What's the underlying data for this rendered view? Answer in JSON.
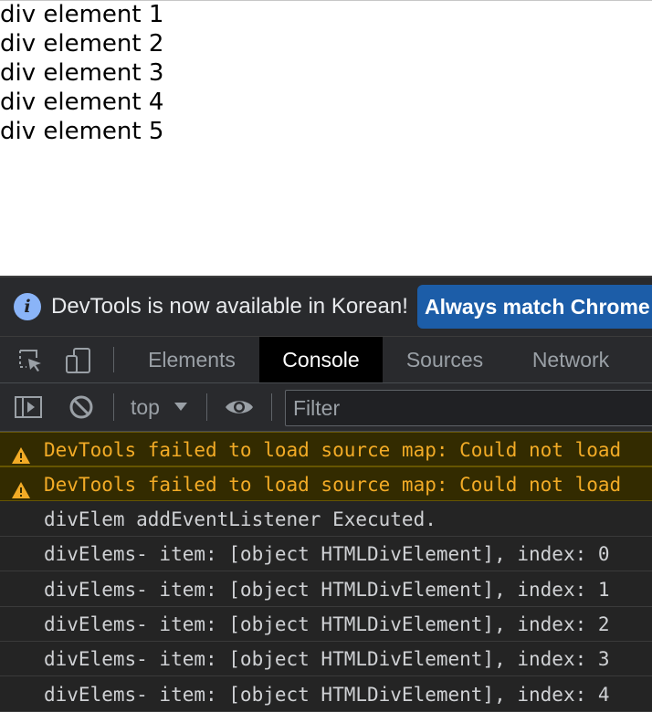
{
  "page": {
    "divs": [
      "div element 1",
      "div element 2",
      "div element 3",
      "div element 4",
      "div element 5"
    ]
  },
  "infobar": {
    "icon": "info-icon",
    "icon_glyph": "i",
    "message": "DevTools is now available in Korean!",
    "button_label": "Always match Chrome"
  },
  "tabbar": {
    "icons": [
      "inspect-element-icon",
      "device-toolbar-icon"
    ],
    "tabs": [
      {
        "label": "Elements",
        "active": false
      },
      {
        "label": "Console",
        "active": true
      },
      {
        "label": "Sources",
        "active": false
      },
      {
        "label": "Network",
        "active": false
      }
    ]
  },
  "console_toolbar": {
    "icons": [
      "sidebar-toggle-icon",
      "clear-console-icon",
      "eye-icon"
    ],
    "context": "top",
    "filter_placeholder": "Filter"
  },
  "console": {
    "messages": [
      {
        "level": "warning",
        "text": "DevTools failed to load source map: Could not load"
      },
      {
        "level": "warning",
        "text": "DevTools failed to load source map: Could not load"
      },
      {
        "level": "log",
        "text": "divElem addEventListener Executed."
      },
      {
        "level": "log",
        "text": "divElems- item: [object HTMLDivElement], index: 0"
      },
      {
        "level": "log",
        "text": "divElems- item: [object HTMLDivElement], index: 1"
      },
      {
        "level": "log",
        "text": "divElems- item: [object HTMLDivElement], index: 2"
      },
      {
        "level": "log",
        "text": "divElems- item: [object HTMLDivElement], index: 3"
      },
      {
        "level": "log",
        "text": "divElems- item: [object HTMLDivElement], index: 4"
      }
    ]
  },
  "colors": {
    "devtools_bg": "#242424",
    "warning_text": "#f2ab26",
    "warning_bg": "#332b00",
    "accent_button": "#1c5da8",
    "info_icon": "#8ab4f8"
  }
}
